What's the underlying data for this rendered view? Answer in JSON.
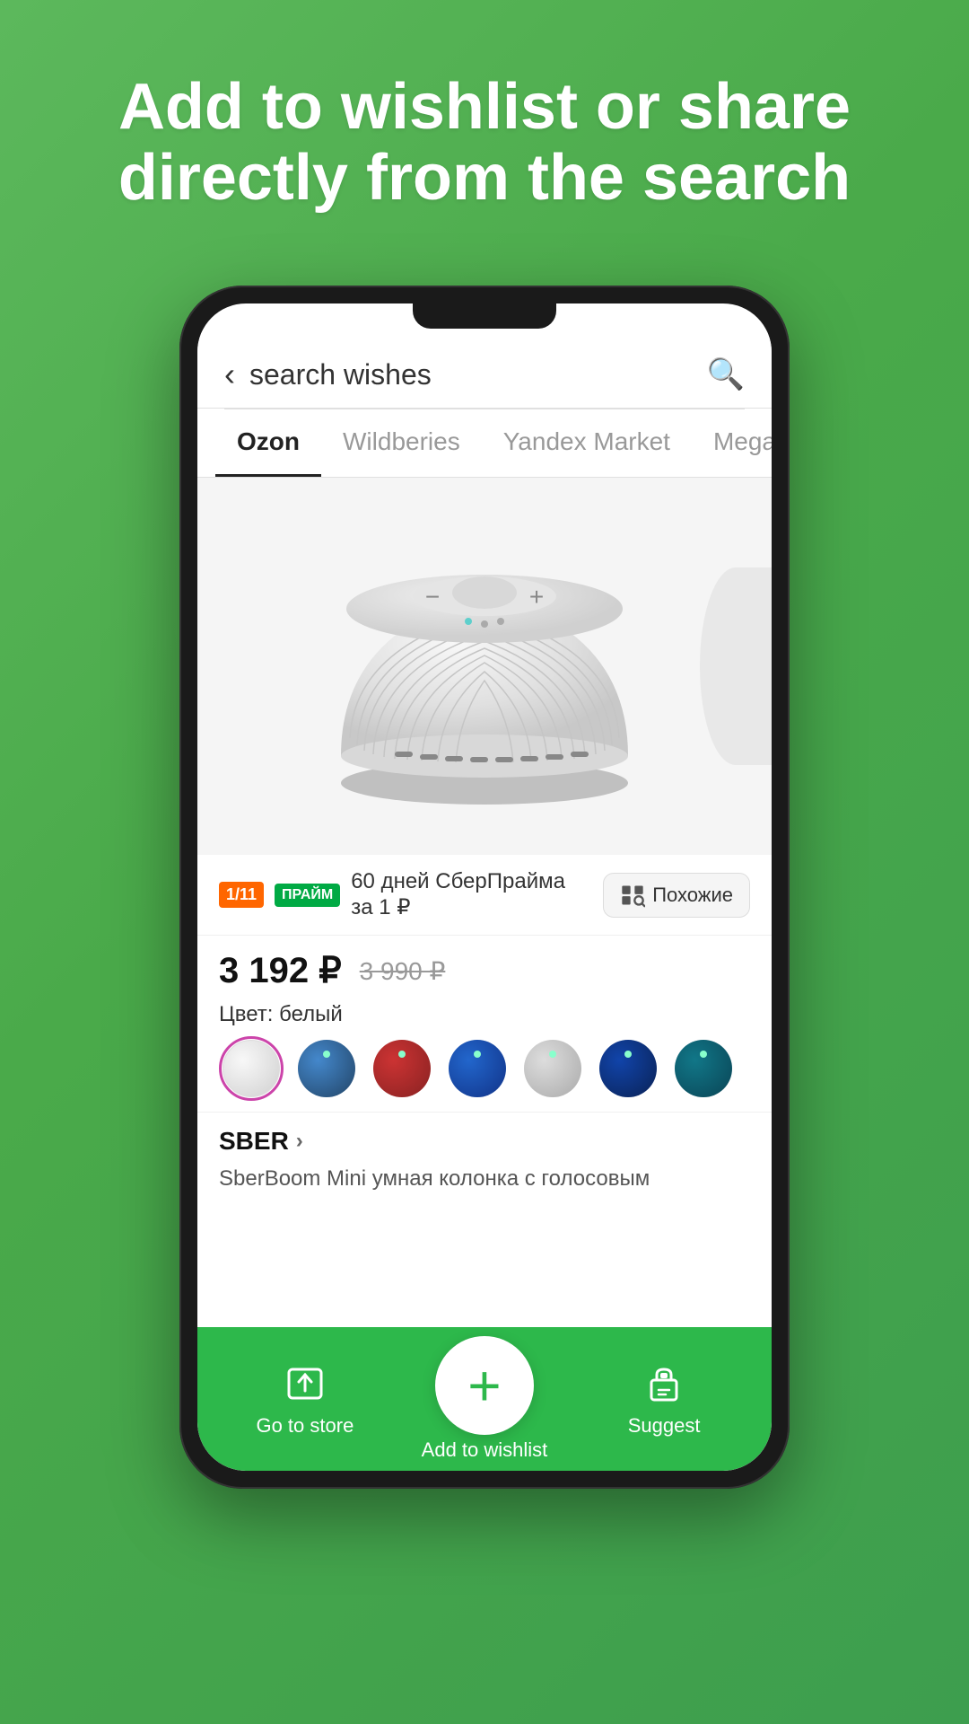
{
  "header": {
    "title": "Add to wishlist or share directly from the search"
  },
  "search": {
    "placeholder": "search wishes",
    "back_label": "‹",
    "search_icon": "🔍"
  },
  "tabs": [
    {
      "label": "Ozon",
      "active": true
    },
    {
      "label": "Wildberies",
      "active": false
    },
    {
      "label": "Yandex Market",
      "active": false
    },
    {
      "label": "Mega",
      "active": false
    }
  ],
  "product": {
    "promo_badge": "1/11",
    "promo_badge2": "ПРАЙМ",
    "promo_text": "60 дней СберПрайма за 1 ₽",
    "similar_btn": "Похожие",
    "price_current": "3 192 ₽",
    "price_old": "3 990 ₽",
    "color_label": "Цвет: белый",
    "brand": "SBER",
    "brand_arrow": "›",
    "description": "SberBoom Mini умная колонка с голосовым"
  },
  "bottom_nav": {
    "store_label": "Go to store",
    "add_label": "Add to wishlist",
    "suggest_label": "Suggest",
    "add_icon": "+",
    "store_icon": "⬆",
    "suggest_icon": "🎁"
  },
  "colors": {
    "accent": "#2db84b",
    "promo_orange": "#ff6600",
    "promo_green": "#00aa44"
  }
}
